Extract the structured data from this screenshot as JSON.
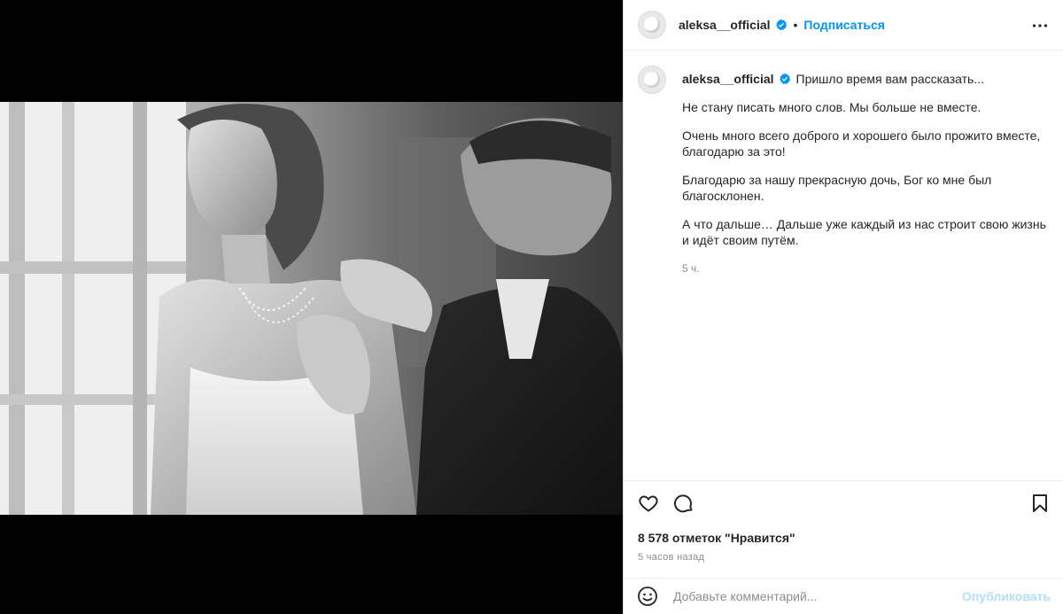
{
  "post": {
    "username": "aleksa__official",
    "follow_label": "Подписаться",
    "separator": "•",
    "caption": {
      "first_line": "Пришло время вам рассказать...",
      "paragraphs": [
        "Не стану писать много слов. Мы больше не вместе.",
        "Очень много всего доброго и хорошего было прожито вместе, благодарю за это!",
        "Благодарю за нашу прекрасную дочь, Бог ко мне был благосклонен.",
        "А что дальше… Дальше уже каждый из нас строит свою жизнь и идёт своим путём."
      ],
      "time": "5 ч."
    },
    "likes": "8 578 отметок \"Нравится\"",
    "posted_ago": "5 часов назад",
    "comment": {
      "placeholder": "Добавьте комментарий...",
      "publish_label": "Опубликовать"
    }
  },
  "icons": {
    "verified": "verified-badge-icon",
    "more": "more-options-icon",
    "like": "heart-icon",
    "comment": "comment-icon",
    "save": "bookmark-icon",
    "emoji": "emoji-icon"
  },
  "colors": {
    "accent": "#0095f6",
    "publish_disabled": "#b2dffc",
    "muted_text": "#8e8e8e",
    "media_background": "#000000"
  }
}
